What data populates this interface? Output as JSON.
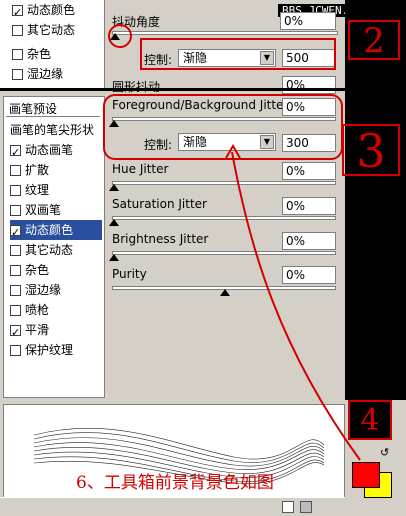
{
  "watermark": "BBS.JCWEN.COM",
  "top_list": [
    "动态颜色",
    "其它动态",
    "杂色",
    "湿边缘"
  ],
  "top_section": {
    "label_angle": "抖动角度",
    "angle_value": "0%",
    "control_label": "控制:",
    "control_value": "渐隐",
    "control_number": "500",
    "roundness_label": "圆形抖动",
    "roundness_value": "0%"
  },
  "panel_title": "画笔预设",
  "sidebar_items": [
    {
      "label": "画笔的笔尖形状",
      "checkbox": false,
      "checked": false,
      "selected": false
    },
    {
      "label": "动态画笔",
      "checkbox": true,
      "checked": true,
      "selected": false
    },
    {
      "label": "扩散",
      "checkbox": true,
      "checked": false,
      "selected": false
    },
    {
      "label": "纹理",
      "checkbox": true,
      "checked": false,
      "selected": false
    },
    {
      "label": "双画笔",
      "checkbox": true,
      "checked": false,
      "selected": false
    },
    {
      "label": "动态颜色",
      "checkbox": true,
      "checked": true,
      "selected": true
    },
    {
      "label": "其它动态",
      "checkbox": true,
      "checked": false,
      "selected": false
    },
    {
      "label": "杂色",
      "checkbox": true,
      "checked": false,
      "selected": false
    },
    {
      "label": "湿边缘",
      "checkbox": true,
      "checked": false,
      "selected": false
    },
    {
      "label": "喷枪",
      "checkbox": true,
      "checked": false,
      "selected": false
    },
    {
      "label": "平滑",
      "checkbox": true,
      "checked": true,
      "selected": false
    },
    {
      "label": "保护纹理",
      "checkbox": true,
      "checked": false,
      "selected": false
    }
  ],
  "color_dynamics": {
    "fg_bg_label": "Foreground/Background Jitter",
    "fg_bg_value": "0%",
    "control_label": "控制:",
    "control_value": "渐隐",
    "control_number": "300",
    "hue_label": "Hue Jitter",
    "hue_value": "0%",
    "saturation_label": "Saturation Jitter",
    "saturation_value": "0%",
    "brightness_label": "Brightness Jitter",
    "brightness_value": "0%",
    "purity_label": "Purity",
    "purity_value": "0%"
  },
  "annotations": {
    "step2": "2",
    "step3": "3",
    "step4": "4",
    "caption": "6、工具箱前景背景色如图"
  },
  "colors": {
    "foreground": "#ff0000",
    "background": "#ffff00",
    "selected": "#2a4f9f",
    "annotation": "#d40000"
  }
}
